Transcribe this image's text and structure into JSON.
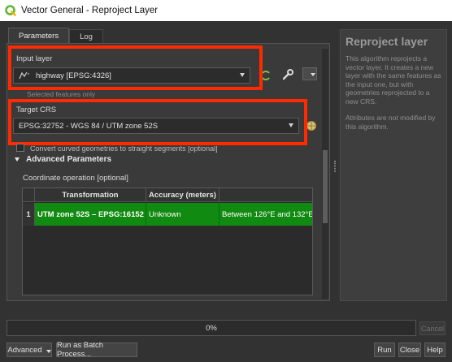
{
  "window": {
    "title": "Vector General - Reproject Layer"
  },
  "tabs": [
    {
      "label": "Parameters"
    },
    {
      "label": "Log"
    }
  ],
  "params": {
    "input_layer_label": "Input layer",
    "input_layer_value": "highway [EPSG:4326]",
    "selected_features_label": "Selected features only",
    "target_crs_label": "Target CRS",
    "target_crs_value": "EPSG:32752 - WGS 84 / UTM zone 52S",
    "convert_curved_label": "Convert curved geometries to straight segments [optional]",
    "advanced_title": "Advanced Parameters",
    "coord_op_label": "Coordinate operation [optional]"
  },
  "table": {
    "columns": [
      "Transformation",
      "Accuracy (meters)",
      ""
    ],
    "rows": [
      {
        "num": "1",
        "transformation": "UTM zone 52S – EPSG:16152",
        "accuracy": "Unknown",
        "area": "Between 126°E and 132°E"
      }
    ]
  },
  "help": {
    "title": "Reproject layer",
    "paragraph1": "This algorithm reprojects a vector layer. It creates a new layer with the same features as the input one, but with geometries reprojected to a new CRS.",
    "paragraph2": "Attributes are not modified by this algorithm."
  },
  "progress": {
    "value": "0%",
    "fraction": 0.0
  },
  "buttons": {
    "cancel": "Cancel",
    "advanced": "Advanced",
    "batch": "Run as Batch Process...",
    "run": "Run",
    "close": "Close",
    "help": "Help"
  },
  "colors": {
    "highlight_red": "#ff2a00",
    "selected_row_green": "#108a10",
    "qgis_green": "#5fb830"
  }
}
